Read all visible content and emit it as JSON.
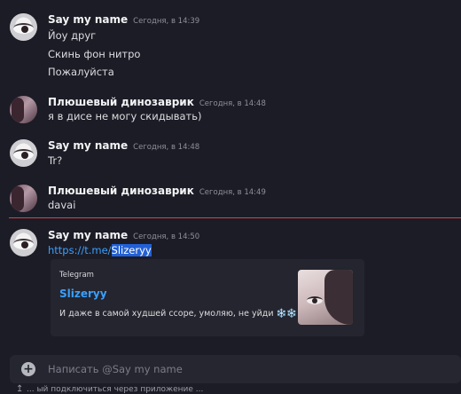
{
  "messages": [
    {
      "author": "Say my name",
      "time": "Сегодня, в 14:39",
      "lines": [
        "Йоу друг",
        "Скинь фон нитро",
        "Пожалуйста"
      ]
    },
    {
      "author": "Плюшевый динозаврик",
      "time": "Сегодня, в 14:48",
      "lines": [
        "я в дисе не могу скидывать)"
      ]
    },
    {
      "author": "Say my name",
      "time": "Сегодня, в 14:48",
      "lines": [
        "Tr?"
      ]
    },
    {
      "author": "Плюшевый динозаврик",
      "time": "Сегодня, в 14:49",
      "lines": [
        "davai"
      ]
    },
    {
      "author": "Say my name",
      "time": "Сегодня, в 14:50",
      "link_prefix": "https://t.me/",
      "link_selected": "Slizeryy"
    }
  ],
  "embed": {
    "provider": "Telegram",
    "title": "Slizeryy",
    "description": "И даже в самой худшей ссоре, умоляю, не уйди ❄️❄️"
  },
  "composer": {
    "placeholder": "Написать @Say my name"
  },
  "bottom_note": "... ый подключиться через приложение ..."
}
